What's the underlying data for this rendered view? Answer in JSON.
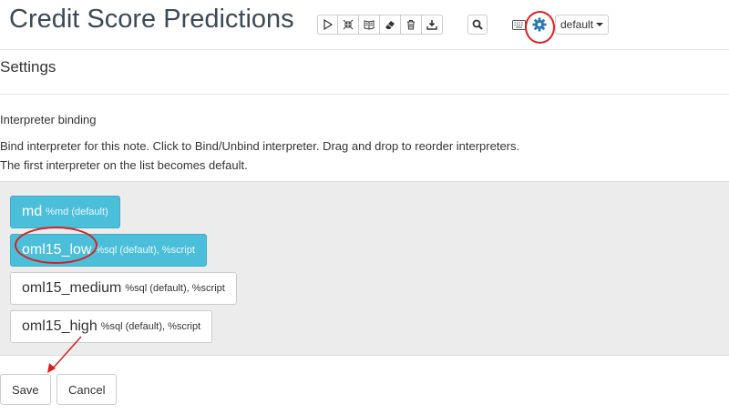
{
  "header": {
    "title": "Credit Score Predictions",
    "toolbar_icons": [
      "run-all-icon",
      "collapse-icon",
      "book-icon",
      "eraser-icon",
      "trash-icon",
      "download-icon"
    ],
    "default_label": "default"
  },
  "settings": {
    "title": "Settings",
    "binding_heading": "Interpreter binding",
    "description_line1": "Bind interpreter for this note. Click to Bind/Unbind interpreter. Drag and drop to reorder interpreters.",
    "description_line2": "The first interpreter on the list becomes default."
  },
  "interpreters": [
    {
      "name": "md",
      "details": "%md (default)",
      "bound": true
    },
    {
      "name": "oml15_low",
      "details": "%sql (default), %script",
      "bound": true
    },
    {
      "name": "oml15_medium",
      "details": "%sql (default), %script",
      "bound": false
    },
    {
      "name": "oml15_high",
      "details": "%sql (default), %script",
      "bound": false
    }
  ],
  "buttons": {
    "save": "Save",
    "cancel": "Cancel"
  },
  "colors": {
    "bound": "#4bbfd9",
    "annotation": "#e02020",
    "gear": "#2a78b8"
  }
}
